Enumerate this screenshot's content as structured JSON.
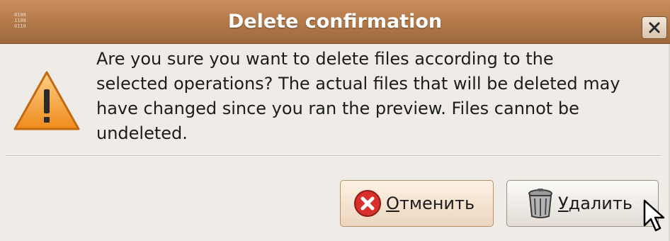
{
  "window": {
    "title": "Delete confirmation",
    "app_icon_text": "0100 1100 0110"
  },
  "dialog": {
    "icon": "warning-icon",
    "message": "Are you sure you want to delete files according to the\nselected operations?  The actual files that will be deleted may\nhave changed since you ran the preview.  Files cannot be\nundeleted."
  },
  "buttons": {
    "cancel": {
      "mnemonic": "О",
      "rest": "тменить",
      "icon": "cancel-circle-icon"
    },
    "delete": {
      "mnemonic": "У",
      "rest": "далить",
      "icon": "trash-can-icon"
    }
  },
  "colors": {
    "titlebar": "#b57b4b",
    "dialog_bg": "#efebe7",
    "warning": "#f5a623",
    "cancel_red": "#d8302a"
  }
}
